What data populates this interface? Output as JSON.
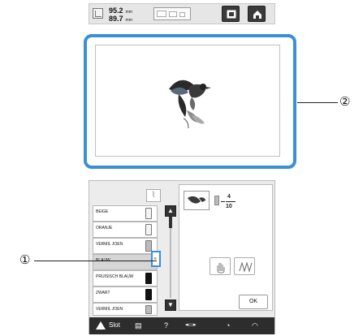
{
  "top_screen": {
    "width_value": "95.2",
    "height_value": "89.7",
    "unit": "mm"
  },
  "thread_list": {
    "items": [
      {
        "name": "BEIGE",
        "spool": "light"
      },
      {
        "name": "ORANJE",
        "spool": "light"
      },
      {
        "name": "VERMIL JOEN",
        "spool": "gray"
      },
      {
        "name": "BLAUW",
        "spool": "gray",
        "selected": true
      },
      {
        "name": "PRUISISCH BLAUW",
        "spool": "dark"
      },
      {
        "name": "ZWART",
        "spool": "dark"
      },
      {
        "name": "VERMIL JOEN",
        "spool": "gray"
      }
    ]
  },
  "color_counter": {
    "current": "4",
    "total": "10"
  },
  "ok_label": "OK",
  "status_bar": {
    "slot_label": "Slot"
  },
  "callouts": {
    "marker_1": "①",
    "marker_2": "②"
  },
  "colors": {
    "accent": "#3a8fd8",
    "status_bar": "#2d2d2d"
  },
  "icons": [
    "size-icon",
    "hoop-icon",
    "home-icon",
    "scroll-up-icon",
    "scroll-down-icon",
    "hand-icon",
    "stitch-icon",
    "warning-icon",
    "wifi-icon"
  ]
}
